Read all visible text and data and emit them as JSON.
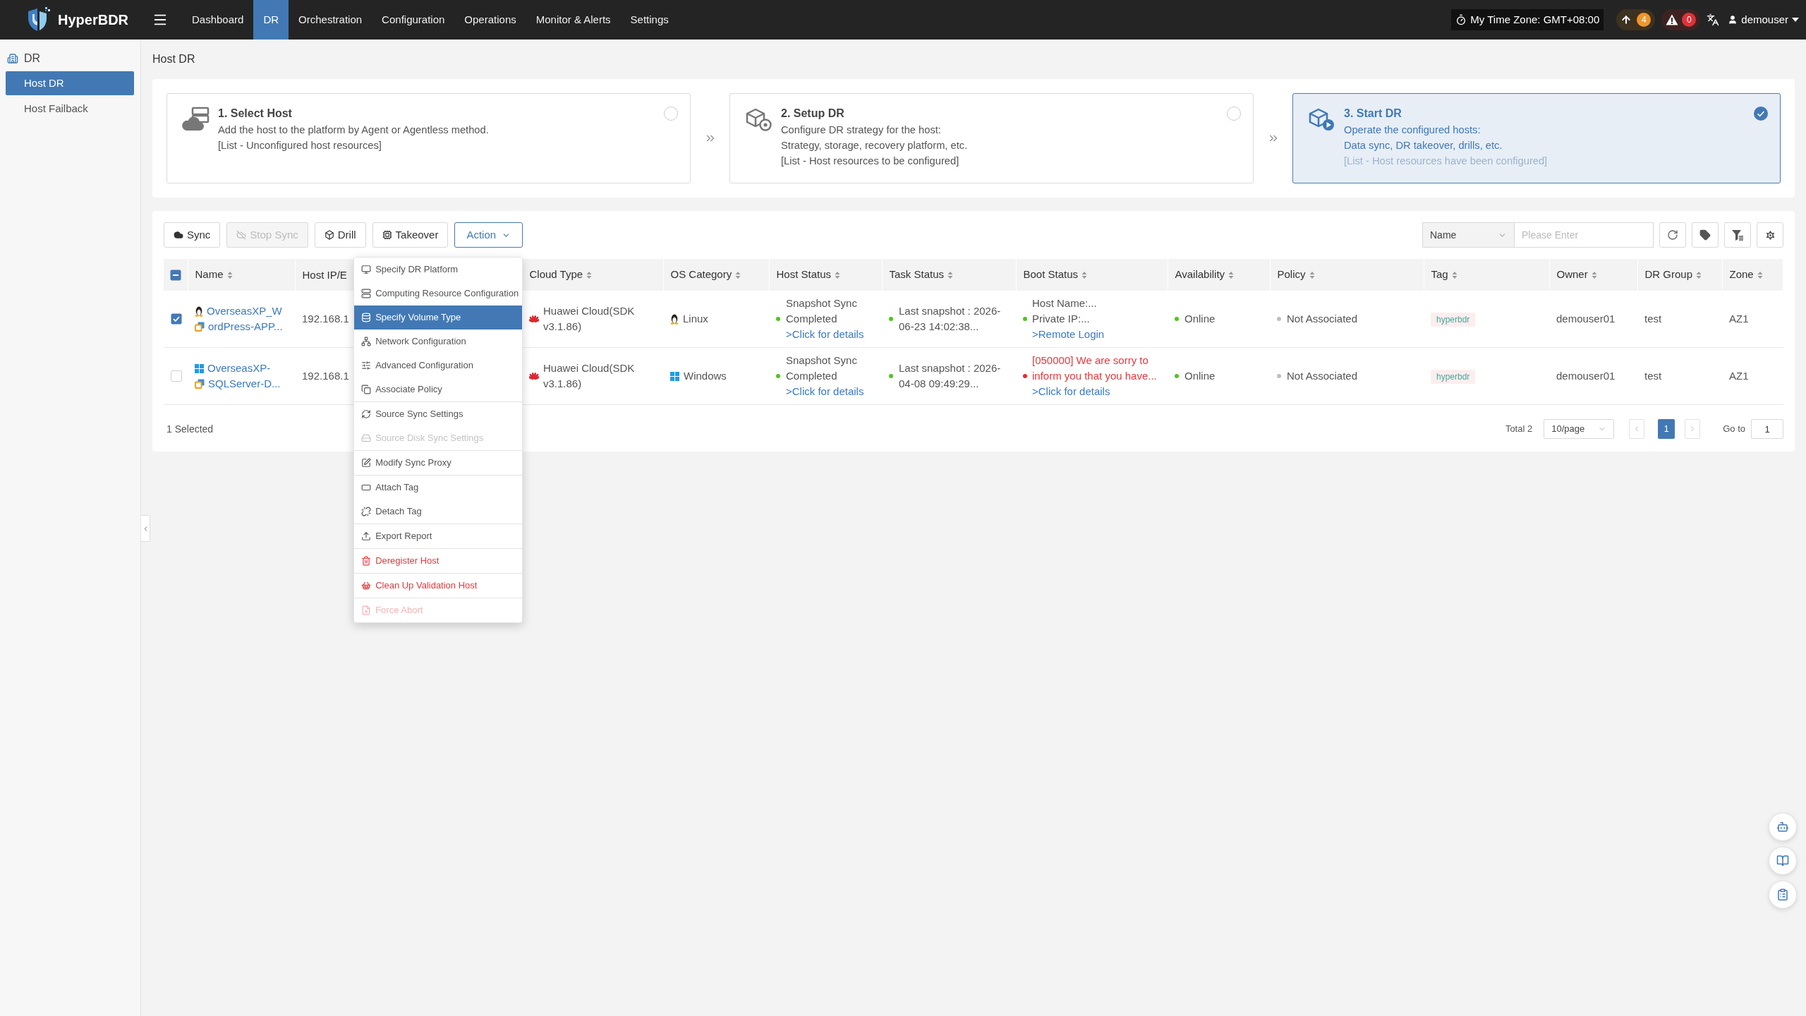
{
  "header": {
    "brand": "HyperBDR",
    "nav": [
      {
        "label": "Dashboard",
        "selected": false
      },
      {
        "label": "DR",
        "selected": true
      },
      {
        "label": "Orchestration",
        "selected": false
      },
      {
        "label": "Configuration",
        "selected": false
      },
      {
        "label": "Operations",
        "selected": false
      },
      {
        "label": "Monitor & Alerts",
        "selected": false
      },
      {
        "label": "Settings",
        "selected": false
      }
    ],
    "time_zone": "My Time Zone: GMT+08:00",
    "upload_count": "4",
    "alert_count": "0",
    "user": "demouser"
  },
  "sidebar": {
    "group": "DR",
    "items": [
      {
        "label": "Host DR",
        "selected": true
      },
      {
        "label": "Host Failback",
        "selected": false
      }
    ]
  },
  "page_title": "Host DR",
  "steps": [
    {
      "title": "1. Select Host",
      "lines": [
        "Add the host to the platform by Agent or Agentless method."
      ],
      "note": "[List - Unconfigured host resources]",
      "selected": false
    },
    {
      "title": "2. Setup DR",
      "lines": [
        "Configure DR strategy for the host:",
        "Strategy, storage, recovery platform, etc."
      ],
      "note": "[List - Host resources to be configured]",
      "selected": false
    },
    {
      "title": "3. Start DR",
      "lines": [
        "Operate the configured hosts:",
        "Data sync, DR takeover, drills, etc."
      ],
      "note": "[List - Host resources have been configured]",
      "selected": true
    }
  ],
  "toolbar": {
    "buttons": [
      {
        "label": "Sync",
        "disabled": false
      },
      {
        "label": "Stop Sync",
        "disabled": true
      },
      {
        "label": "Drill",
        "disabled": false
      },
      {
        "label": "Takeover",
        "disabled": false
      }
    ],
    "action": {
      "label": "Action",
      "expanded": true,
      "menu": [
        [
          {
            "label": "Specify DR Platform",
            "selected": false,
            "disabled": false,
            "kind": "normal"
          },
          {
            "label": "Computing Resource Configuration",
            "selected": false,
            "disabled": false,
            "kind": "normal"
          },
          {
            "label": "Specify Volume Type",
            "selected": true,
            "disabled": false,
            "kind": "normal"
          },
          {
            "label": "Network Configuration",
            "selected": false,
            "disabled": false,
            "kind": "normal"
          },
          {
            "label": "Advanced Configuration",
            "selected": false,
            "disabled": false,
            "kind": "normal"
          },
          {
            "label": "Associate Policy",
            "selected": false,
            "disabled": false,
            "kind": "normal"
          }
        ],
        [
          {
            "label": "Source Sync Settings",
            "selected": false,
            "disabled": false,
            "kind": "normal"
          },
          {
            "label": "Source Disk Sync Settings",
            "selected": false,
            "disabled": true,
            "kind": "normal"
          }
        ],
        [
          {
            "label": "Modify Sync Proxy",
            "selected": false,
            "disabled": false,
            "kind": "normal"
          }
        ],
        [
          {
            "label": "Attach Tag",
            "selected": false,
            "disabled": false,
            "kind": "normal"
          },
          {
            "label": "Detach Tag",
            "selected": false,
            "disabled": false,
            "kind": "normal"
          }
        ],
        [
          {
            "label": "Export Report",
            "selected": false,
            "disabled": false,
            "kind": "normal"
          }
        ],
        [
          {
            "label": "Deregister Host",
            "selected": false,
            "disabled": false,
            "kind": "danger"
          }
        ],
        [
          {
            "label": "Clean Up Validation Host",
            "selected": false,
            "disabled": false,
            "kind": "danger"
          }
        ],
        [
          {
            "label": "Force Abort",
            "selected": false,
            "disabled": true,
            "kind": "danger"
          }
        ]
      ]
    },
    "search": {
      "field": "Name",
      "placeholder": "Please Enter"
    }
  },
  "table": {
    "select_all": {
      "partial": true
    },
    "columns": [
      {
        "label": "Name",
        "sortable": true
      },
      {
        "label": "Host IP/E",
        "sortable": false
      },
      {
        "label": "Cloud Type",
        "sortable": true
      },
      {
        "label": "OS Category",
        "sortable": true
      },
      {
        "label": "Host Status",
        "sortable": true
      },
      {
        "label": "Task Status",
        "sortable": true
      },
      {
        "label": "Boot Status",
        "sortable": true
      },
      {
        "label": "Availability",
        "sortable": true
      },
      {
        "label": "Policy",
        "sortable": true
      },
      {
        "label": "Tag",
        "sortable": true
      },
      {
        "label": "Owner",
        "sortable": true
      },
      {
        "label": "DR Group",
        "sortable": true
      },
      {
        "label": "Zone",
        "sortable": true
      }
    ],
    "rows": [
      {
        "checked": true,
        "kind": "linux",
        "name_lines": [
          "OverseasXP_W",
          "ordPress-APP..."
        ],
        "host_ip": "192.168.1",
        "cloud_type": "Huawei Cloud(SDK v3.1.86)",
        "os_category": "Linux",
        "host_status": {
          "text": "Snapshot Sync Completed",
          "link": ">Click for details",
          "color": "#52c41a"
        },
        "task_status": {
          "text": "Last snapshot : 2026-06-23 14:02:38...",
          "color": "#52c41a"
        },
        "boot_status": {
          "kind": "info",
          "lines": [
            "Host Name:...",
            "Private IP:..."
          ],
          "link": ">Remote Login",
          "color": "#52c41a"
        },
        "availability": {
          "text": "Online",
          "color": "#52c41a"
        },
        "policy": {
          "text": "Not Associated",
          "color": "#bfbfbf"
        },
        "tag": "hyperbdr",
        "owner": "demouser01",
        "dr_group": "test",
        "zone": "AZ1"
      },
      {
        "checked": false,
        "kind": "windows",
        "name_lines": [
          "OverseasXP-",
          "SQLServer-D..."
        ],
        "host_ip": "192.168.1",
        "cloud_type": "Huawei Cloud(SDK v3.1.86)",
        "os_category": "Windows",
        "host_status": {
          "text": "Snapshot Sync Completed",
          "link": ">Click for details",
          "color": "#52c41a"
        },
        "task_status": {
          "text": "Last snapshot : 2026-04-08 09:49:29...",
          "color": "#52c41a"
        },
        "boot_status": {
          "kind": "error",
          "lines": [
            "[050000] We are sorry to inform you that you have..."
          ],
          "link": ">Click for details",
          "color": "#f5222d"
        },
        "availability": {
          "text": "Online",
          "color": "#52c41a"
        },
        "policy": {
          "text": "Not Associated",
          "color": "#bfbfbf"
        },
        "tag": "hyperbdr",
        "owner": "demouser01",
        "dr_group": "test",
        "zone": "AZ1"
      }
    ]
  },
  "footer": {
    "selected": "1 Selected",
    "total": "Total 2",
    "page_size": "10/page",
    "pages": [
      {
        "label": "1",
        "selected": true
      }
    ],
    "goto_label": "Go to",
    "goto_value": "1"
  }
}
